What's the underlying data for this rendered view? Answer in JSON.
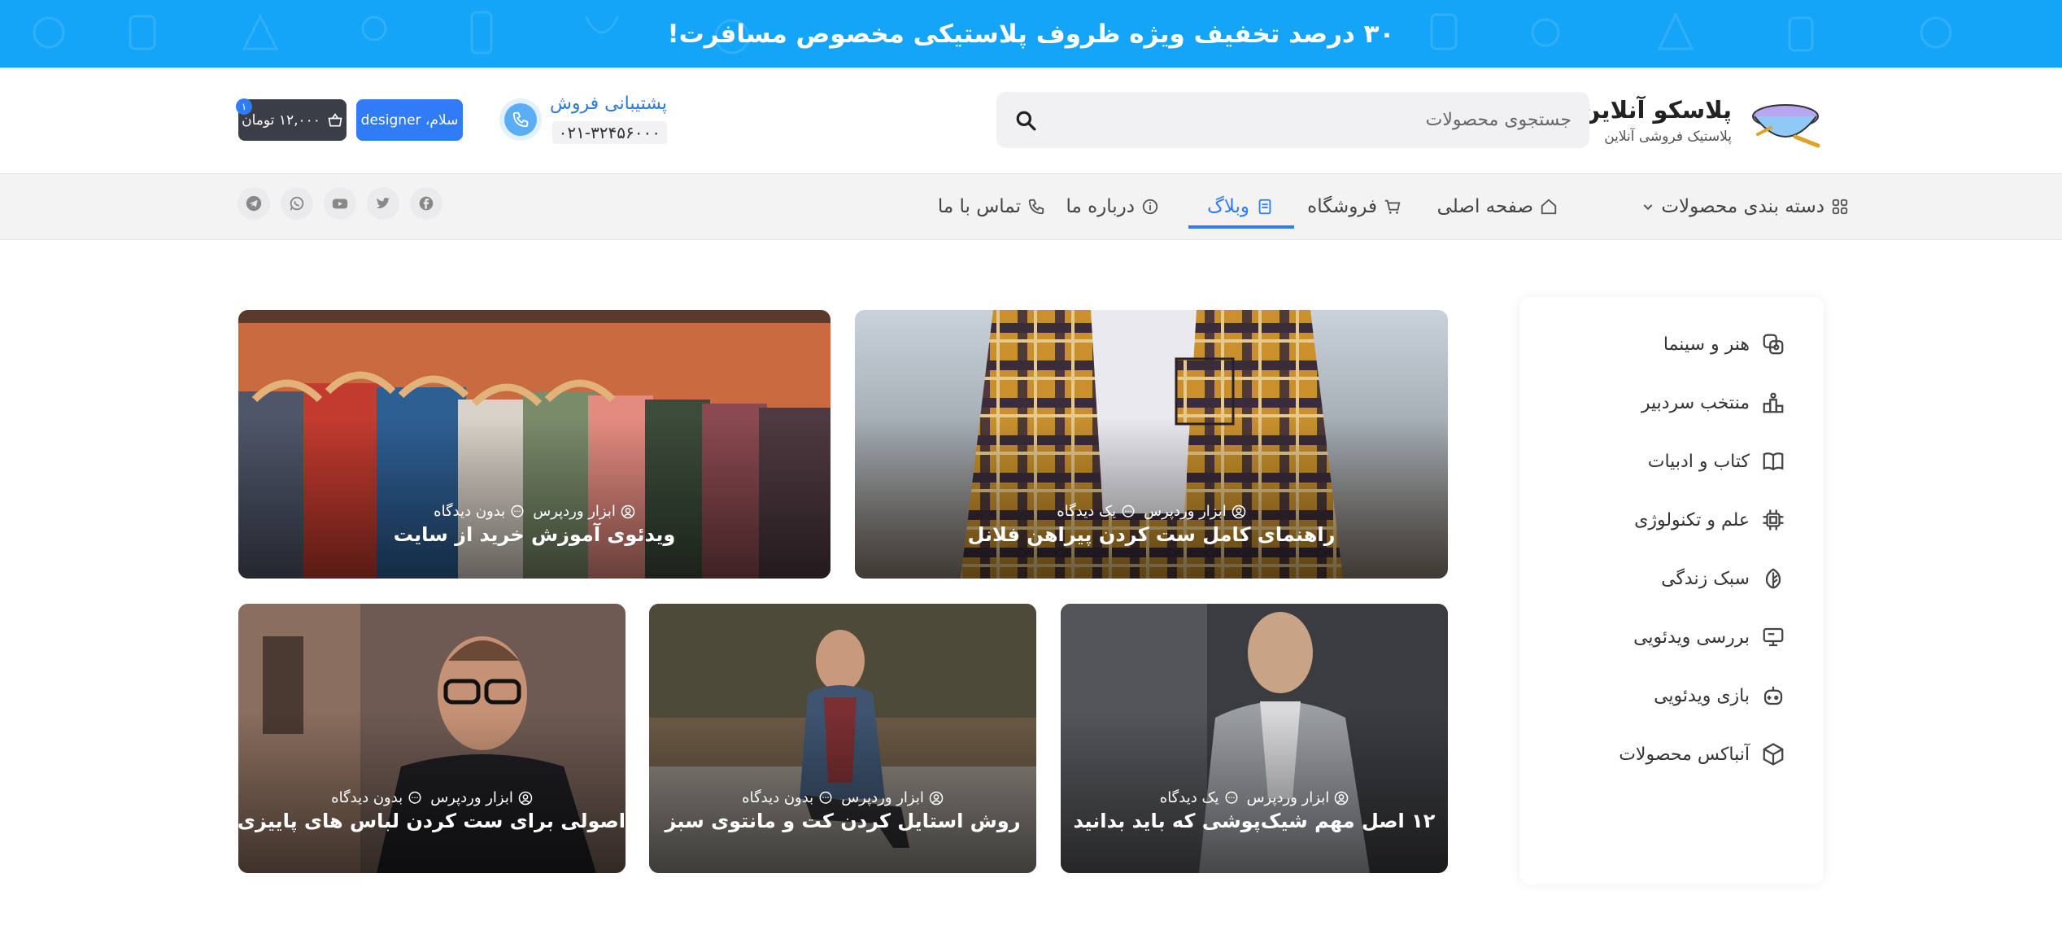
{
  "banner": {
    "text": "۳۰ درصد تخفیف ویژه ظروف پلاستیکی مخصوص مسافرت!",
    "background": "#14a4f8"
  },
  "header": {
    "brand": "پلاسکو آنلاین!",
    "tagline": "پلاستیک فروشی آنلاین",
    "search": {
      "placeholder": "جستجوی محصولات"
    },
    "support": {
      "title": "پشتیبانی فروش",
      "phone": "۰۲۱-۳۲۴۵۶۰۰۰"
    },
    "user_label": "سلام، designer",
    "cart": {
      "amount": "۱۲,۰۰۰ تومان",
      "count": "۱"
    }
  },
  "nav": {
    "categories": "دسته بندی محصولات",
    "home": "صفحه اصلی",
    "shop": "فروشگاه",
    "blog": "وبلاگ",
    "about": "درباره ما",
    "contact": "تماس با ما",
    "social": [
      "facebook-icon",
      "twitter-icon",
      "youtube-icon",
      "whatsapp-icon",
      "telegram-icon"
    ]
  },
  "sidebar": {
    "items": [
      {
        "label": "هنر و سینما",
        "icon": "film-icon"
      },
      {
        "label": "منتخب سردبیر",
        "icon": "podium-icon"
      },
      {
        "label": "کتاب و ادبیات",
        "icon": "book-icon"
      },
      {
        "label": "علم و تکنولوژی",
        "icon": "chip-icon"
      },
      {
        "label": "سبک زندگی",
        "icon": "leaf-icon"
      },
      {
        "label": "بررسی ویدئویی",
        "icon": "monitor-icon"
      },
      {
        "label": "بازی ویدئویی",
        "icon": "gamepad-icon"
      },
      {
        "label": "آنباکس محصولات",
        "icon": "box-icon"
      }
    ]
  },
  "posts": [
    {
      "title": "راهنمای کامل ست کردن پیراهن فلانل",
      "author": "ابزار وردپرس",
      "comments": "یک دیدگاه"
    },
    {
      "title": "ویدئوی آموزش خرید از سایت",
      "author": "ابزار وردپرس",
      "comments": "بدون دیدگاه"
    },
    {
      "title": "۱۲ اصل مهم شیک‌پوشی که باید بدانید",
      "author": "ابزار وردپرس",
      "comments": "یک دیدگاه"
    },
    {
      "title": "روش استایل کردن کت و مانتوی سبز",
      "author": "ابزار وردپرس",
      "comments": "بدون دیدگاه"
    },
    {
      "title": "اصولی برای ست کردن لباس های پاییزی",
      "author": "ابزار وردپرس",
      "comments": "بدون دیدگاه"
    }
  ],
  "colors": {
    "accent": "#2f7cf6",
    "banner": "#14a4f8",
    "cart": "#3b3e47"
  }
}
